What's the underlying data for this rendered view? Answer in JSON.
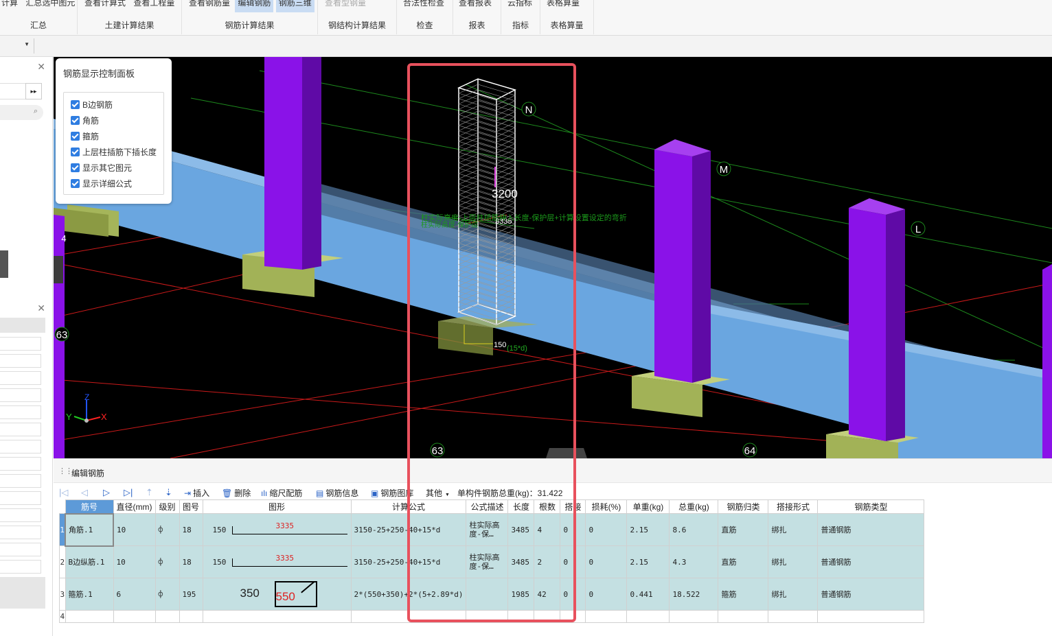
{
  "ribbon": {
    "groups": [
      {
        "label": "汇总",
        "buttons": [
          {
            "text": "计算",
            "active": false
          },
          {
            "text": "汇总选中图元",
            "active": false
          }
        ]
      },
      {
        "label": "土建计算结果",
        "buttons": [
          {
            "text": "查看计算式",
            "active": false
          },
          {
            "text": "查看工程量",
            "active": false
          }
        ]
      },
      {
        "label": "钢筋计算结果",
        "buttons": [
          {
            "text": "查看钢筋量",
            "active": false
          },
          {
            "text": "编辑钢筋",
            "active": true
          },
          {
            "text": "钢筋三维",
            "active": true
          }
        ]
      },
      {
        "label": "钢结构计算结果",
        "buttons": [
          {
            "text": "查看型钢量",
            "disabled": true
          }
        ]
      },
      {
        "label": "检查",
        "buttons": [
          {
            "text": "合法性检查",
            "active": false
          }
        ]
      },
      {
        "label": "报表",
        "buttons": [
          {
            "text": "查看报表",
            "active": false
          }
        ]
      },
      {
        "label": "指标",
        "buttons": [
          {
            "text": "云指标",
            "active": false
          }
        ]
      },
      {
        "label": "表格算量",
        "buttons": [
          {
            "text": "表格算量",
            "active": false
          }
        ]
      }
    ]
  },
  "control_panel": {
    "title": "钢筋显示控制面板",
    "options": [
      {
        "label": "B边钢筋",
        "checked": true
      },
      {
        "label": "角筋",
        "checked": true
      },
      {
        "label": "箍筋",
        "checked": true
      },
      {
        "label": "上层柱插筋下插长度",
        "checked": true
      },
      {
        "label": "显示其它图元",
        "checked": true
      },
      {
        "label": "显示详细公式",
        "checked": true
      }
    ]
  },
  "viewport": {
    "axis_labels": {
      "n": "N",
      "m": "M",
      "l": "L",
      "c63": "63",
      "c64": "64",
      "c63_left": "63",
      "c4": "4"
    },
    "dims": {
      "d3200": "3200",
      "d3335": "3335",
      "d150": "150",
      "anchor": "(15*d)"
    },
    "annotation": "柱实际高度-上层柱插筋伸入长度-保护层+计算设置设定的弯折",
    "annotation2": "柱实际高度-保护层",
    "axes": {
      "x": "X",
      "y": "Y",
      "z": "Z"
    }
  },
  "editor": {
    "title": "编辑钢筋",
    "toolbar": {
      "insert": "插入",
      "delete": "删除",
      "scale": "缩尺配筋",
      "info": "钢筋信息",
      "library": "钢筋图库",
      "other": "其他",
      "total": "单构件钢筋总重(kg)：31.422"
    },
    "columns": [
      "筋号",
      "直径(mm)",
      "级别",
      "图号",
      "图形",
      "计算公式",
      "公式描述",
      "长度",
      "根数",
      "搭接",
      "损耗(%)",
      "单重(kg)",
      "总重(kg)",
      "钢筋归类",
      "搭接形式",
      "钢筋类型"
    ],
    "rows": [
      {
        "no": "1",
        "name": "角筋.1",
        "dia": "10",
        "grade": "⌽",
        "fig": "18",
        "shape_left": "150",
        "shape_len": "3335",
        "formula": "3150-25+250-40+15*d",
        "desc": "柱实际高度-保…",
        "len": "3485",
        "count": "4",
        "lap": "0",
        "loss": "0",
        "unit": "2.15",
        "total": "8.6",
        "cat": "直筋",
        "lap_type": "绑扎",
        "type": "普通钢筋"
      },
      {
        "no": "2",
        "name": "B边纵筋.1",
        "dia": "10",
        "grade": "⌽",
        "fig": "18",
        "shape_left": "150",
        "shape_len": "3335",
        "formula": "3150-25+250-40+15*d",
        "desc": "柱实际高度-保…",
        "len": "3485",
        "count": "2",
        "lap": "0",
        "loss": "0",
        "unit": "2.15",
        "total": "4.3",
        "cat": "直筋",
        "lap_type": "绑扎",
        "type": "普通钢筋"
      },
      {
        "no": "3",
        "name": "箍筋.1",
        "dia": "6",
        "grade": "⌽",
        "fig": "195",
        "shape_left": "350",
        "shape_len": "550",
        "formula": "2*(550+350)+2*(5+2.89*d)",
        "desc": "",
        "len": "1985",
        "count": "42",
        "lap": "0",
        "loss": "0",
        "unit": "0.441",
        "total": "18.522",
        "cat": "箍筋",
        "lap_type": "绑扎",
        "type": "普通钢筋"
      }
    ],
    "empty_row_no": "4"
  },
  "colors": {
    "highlight": "#e8515d",
    "row_bg": "#c4e0e2",
    "selected_header": "#5d9ad8",
    "beam": "#6aa6e0",
    "column": "#8a12e8",
    "footing": "#9aa84e"
  }
}
